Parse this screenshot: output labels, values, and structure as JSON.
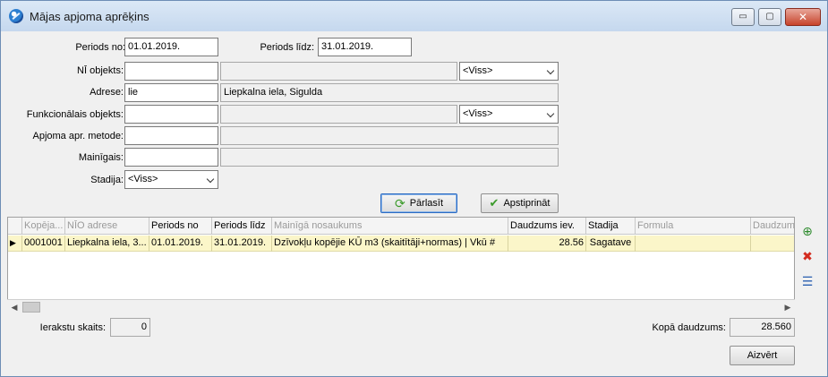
{
  "window": {
    "title": "Mājas apjoma aprēķins",
    "min": "▭",
    "max": "▢",
    "close": "✕"
  },
  "form": {
    "period_from_label": "Periods no:",
    "period_from_value": "01.01.2019.",
    "period_to_label": "Periods līdz:",
    "period_to_value": "31.01.2019.",
    "ni_object_label": "NĪ objekts:",
    "ni_object_value": "",
    "ni_object_desc": "",
    "ni_object_filter": "<Viss>",
    "address_label": "Adrese:",
    "address_value": "lie",
    "address_desc": "Liepkalna iela, Sigulda",
    "func_object_label": "Funkcionālais objekts:",
    "func_object_value": "",
    "func_object_desc": "",
    "func_object_filter": "<Viss>",
    "method_label": "Apjoma apr. metode:",
    "method_value": "",
    "method_desc": "",
    "variable_label": "Mainīgais:",
    "variable_value": "",
    "variable_desc": "",
    "stage_label": "Stadija:",
    "stage_value": "<Viss>"
  },
  "actions": {
    "reload_label": "Pārlasīt",
    "confirm_label": "Apstiprināt"
  },
  "table": {
    "columns": [
      "Kopēja...",
      "NĪO adrese",
      "Periods no",
      "Periods līdz",
      "Mainīgā nosaukums",
      "Daudzums iev.",
      "Stadija",
      "Formula",
      "Daudzums"
    ],
    "rows": [
      [
        "0001001",
        "Liepkalna iela, 3...",
        "01.01.2019.",
        "31.01.2019.",
        "Dzīvokļu kopējie KŪ m3 (skaitītāji+normas) | Vkū #",
        "28.56",
        "Sagatave",
        "",
        ""
      ]
    ]
  },
  "footer": {
    "records_label": "Ierakstu skaits:",
    "records_value": "0",
    "total_label": "Kopā daudzums:",
    "total_value": "28.560",
    "close_label": "Aizvērt"
  }
}
